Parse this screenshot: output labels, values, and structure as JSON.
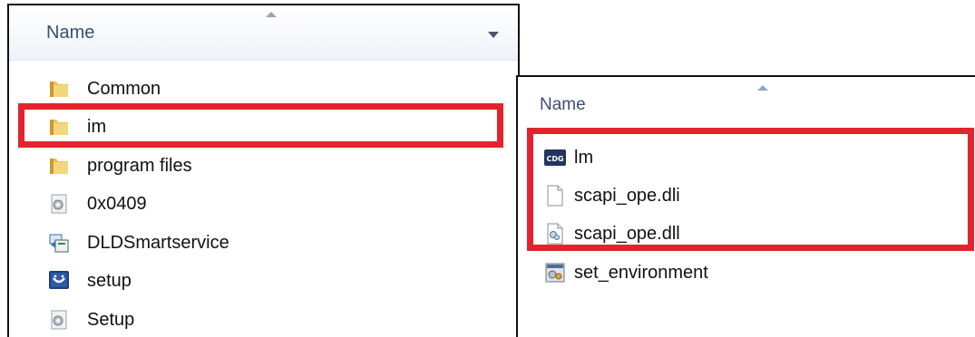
{
  "left_pane": {
    "column_header": "Name",
    "items": [
      {
        "label": "Common",
        "icon": "folder-icon"
      },
      {
        "label": "im",
        "icon": "folder-icon"
      },
      {
        "label": "program files",
        "icon": "folder-icon"
      },
      {
        "label": "0x0409",
        "icon": "settings-file-icon"
      },
      {
        "label": "DLDSmartservice",
        "icon": "installer-icon"
      },
      {
        "label": "setup",
        "icon": "setup-app-icon"
      },
      {
        "label": "Setup",
        "icon": "settings-file-icon"
      }
    ]
  },
  "right_pane": {
    "column_header": "Name",
    "items": [
      {
        "label": "lm",
        "icon": "cdg-app-icon"
      },
      {
        "label": "scapi_ope.dli",
        "icon": "blank-file-icon"
      },
      {
        "label": "scapi_ope.dll",
        "icon": "dll-file-icon"
      },
      {
        "label": "set_environment",
        "icon": "batch-file-icon"
      }
    ]
  },
  "colors": {
    "highlight": "#e3242d",
    "header_text": "#3b4e74",
    "folder": "#e8c25a"
  }
}
